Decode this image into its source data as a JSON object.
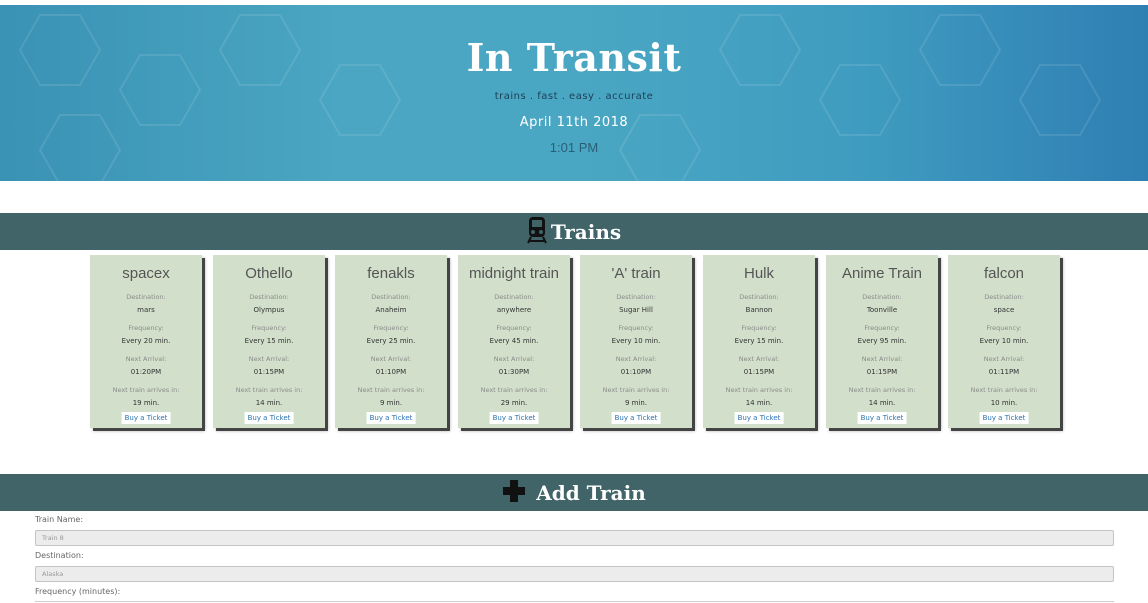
{
  "header": {
    "title": "In Transit",
    "tagline": "trains . fast . easy . accurate",
    "date": "April 11th 2018",
    "time": "1:01 PM"
  },
  "trains_section": {
    "title": "Trains",
    "icon": "train-icon",
    "labels": {
      "destination": "Destination:",
      "frequency": "Frequency:",
      "next_arrival": "Next Arrival:",
      "arrives_in": "Next train arrives in:"
    },
    "ticket_label": "Buy a Ticket",
    "trains": [
      {
        "name": "spacex",
        "destination": "mars",
        "frequency": "Every 20 min.",
        "next_arrival": "01:20PM",
        "arrives_in": "19 min."
      },
      {
        "name": "Othello",
        "destination": "Olympus",
        "frequency": "Every 15 min.",
        "next_arrival": "01:15PM",
        "arrives_in": "14 min."
      },
      {
        "name": "fenakls",
        "destination": "Anaheim",
        "frequency": "Every 25 min.",
        "next_arrival": "01:10PM",
        "arrives_in": "9 min."
      },
      {
        "name": "midnight train",
        "destination": "anywhere",
        "frequency": "Every 45 min.",
        "next_arrival": "01:30PM",
        "arrives_in": "29 min."
      },
      {
        "name": "'A' train",
        "destination": "Sugar Hill",
        "frequency": "Every 10 min.",
        "next_arrival": "01:10PM",
        "arrives_in": "9 min."
      },
      {
        "name": "Hulk",
        "destination": "Bannon",
        "frequency": "Every 15 min.",
        "next_arrival": "01:15PM",
        "arrives_in": "14 min."
      },
      {
        "name": "Anime Train",
        "destination": "Toonville",
        "frequency": "Every 95 min.",
        "next_arrival": "01:15PM",
        "arrives_in": "14 min."
      },
      {
        "name": "falcon",
        "destination": "space",
        "frequency": "Every 10 min.",
        "next_arrival": "01:11PM",
        "arrives_in": "10 min."
      }
    ]
  },
  "add_section": {
    "title": "Add Train",
    "icon": "plus-icon",
    "fields": [
      {
        "label": "Train Name:",
        "placeholder": "Train 8"
      },
      {
        "label": "Destination:",
        "placeholder": "Alaska"
      },
      {
        "label": "Frequency (minutes):",
        "placeholder": ""
      }
    ]
  },
  "colors": {
    "section_bar": "#406468",
    "card_bg": "#d2e0cb",
    "header_blue": "#4aa6c2",
    "ticket_text": "#2a72b0"
  }
}
